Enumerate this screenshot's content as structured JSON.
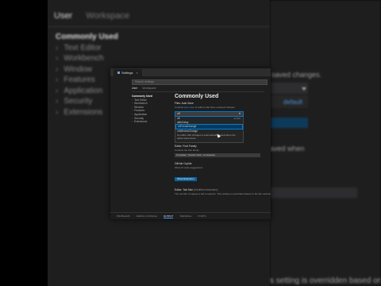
{
  "background": {
    "scope_tabs": [
      "User",
      "Workspace"
    ],
    "tree_head": "Commonly Used",
    "tree_items": [
      "Text Editor",
      "Workbench",
      "Window",
      "Features",
      "Application",
      "Security",
      "Extensions"
    ],
    "fragments": {
      "saved_changes": "saved changes.",
      "default_badge": "default",
      "saved_when": "aved when",
      "bottom_text": "s setting is overridden based on the fil"
    }
  },
  "window": {
    "tab_title": "Settings",
    "tab_close": "×",
    "search_placeholder": "Search settings",
    "scope_user": "User",
    "scope_workspace": "Workspace",
    "nav_head": "Commonly Used",
    "nav_items": [
      "Text Editor",
      "Workbench",
      "Window",
      "Features",
      "Application",
      "Security",
      "Extensions"
    ],
    "heading": "Commonly Used",
    "autosave": {
      "label": "Files: Auto Save",
      "desc_prefix": "Controls",
      "desc_link": "auto save",
      "desc_suffix": "of editors that have unsaved changes.",
      "selected": "off",
      "options": [
        {
          "label": "off",
          "default": "default"
        },
        {
          "label": "afterDelay",
          "default": ""
        },
        {
          "label": "onFocusChange",
          "default": ""
        },
        {
          "label": "onWindowChange",
          "default": ""
        }
      ],
      "option_desc": "An editor with changes is automatically saved when the editor loses focus."
    },
    "font": {
      "label": "Editor: Font Family",
      "desc": "Controls the font family.",
      "value": "Consolas, 'Courier New', monospace"
    },
    "copilot": {
      "label": "GitHub Copilot",
      "desc": "Show AI code suggestions.",
      "button": "Show Extension"
    },
    "tabsize": {
      "label": "Editor: Tab Size",
      "label_suffix": "(Modified elsewhere)",
      "desc": "The number of spaces a tab is equal to. This setting is overridden based on the file contents."
    },
    "statusbar": [
      "PROBLEMS",
      "DEBUG CONSOLE",
      "OUTPUT",
      "TERMINAL",
      "PORTS"
    ],
    "statusbar_active_index": 2
  }
}
